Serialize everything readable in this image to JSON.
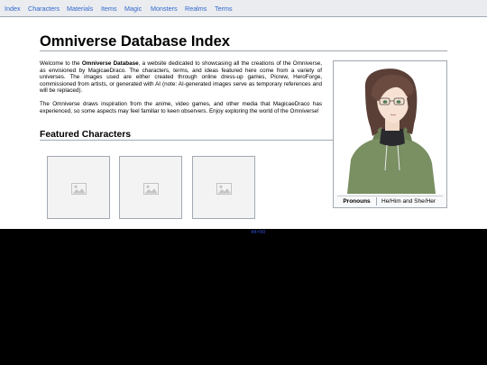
{
  "nav": {
    "items": [
      "Index",
      "Characters",
      "Materials",
      "Items",
      "Magic",
      "Monsters",
      "Realms",
      "Terms"
    ]
  },
  "page": {
    "title": "Omniverse Database Index",
    "intro_prefix": "Welcome to the ",
    "intro_bold": "Omniverse Database",
    "intro_rest": ", a website dedicated to showcasing all the creations of the Omniverse, as envisioned by MagicaeDraco. The characters, terms, and ideas featured here come from a variety of universes. The images used are either created through online dress-up games, Picrew, HeroForge, commissioned from artists, or generated with AI (note: AI-generated images serve as temporary references and will be replaced).",
    "paragraph2": "The Omniverse draws inspiration from the anime, video games, and other media that MagicaeDraco has experienced, so some aspects may feel familiar to keen observers. Enjoy exploring the world of the Omniverse!",
    "featured_heading": "Featured Characters"
  },
  "featured": {
    "cards": [
      {
        "icon": "image-placeholder-icon"
      },
      {
        "icon": "image-placeholder-icon"
      },
      {
        "icon": "image-placeholder-icon"
      }
    ]
  },
  "infobox": {
    "pronouns_label": "Pronouns",
    "pronouns_value": "He/Him and She/Her"
  },
  "overlay": {
    "dimension_label": "44×50"
  },
  "colors": {
    "link": "#3366cc",
    "nav_bg": "#eaecf0",
    "border": "#a2a9b1",
    "hoodie": "#7a8f62"
  }
}
